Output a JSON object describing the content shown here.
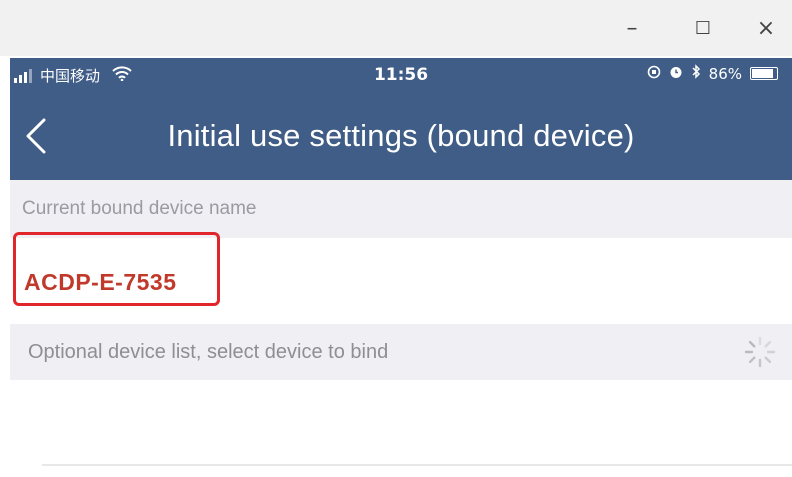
{
  "window": {
    "minimize_glyph": "–",
    "maximize_glyph": "☐",
    "close_glyph": "×"
  },
  "status_bar": {
    "carrier": "中国移动",
    "time": "11:56",
    "battery": "86%",
    "icons": [
      "signal-icon",
      "wifi-icon",
      "orientation-lock-icon",
      "alarm-icon",
      "bluetooth-icon",
      "battery-icon"
    ]
  },
  "nav": {
    "title": "Initial use settings (bound device)",
    "back_icon": "chevron-left-icon"
  },
  "bound_section": {
    "header": "Current bound device name",
    "device_name": "ACDP-E-7535"
  },
  "device_list_section": {
    "header": "Optional device list, select device to bind",
    "loading_icon": "spinner-icon"
  },
  "colors": {
    "header_bg": "#3f5d86",
    "section_bg": "#efeff4",
    "device_text": "#c0392b",
    "highlight": "#e0262b"
  }
}
